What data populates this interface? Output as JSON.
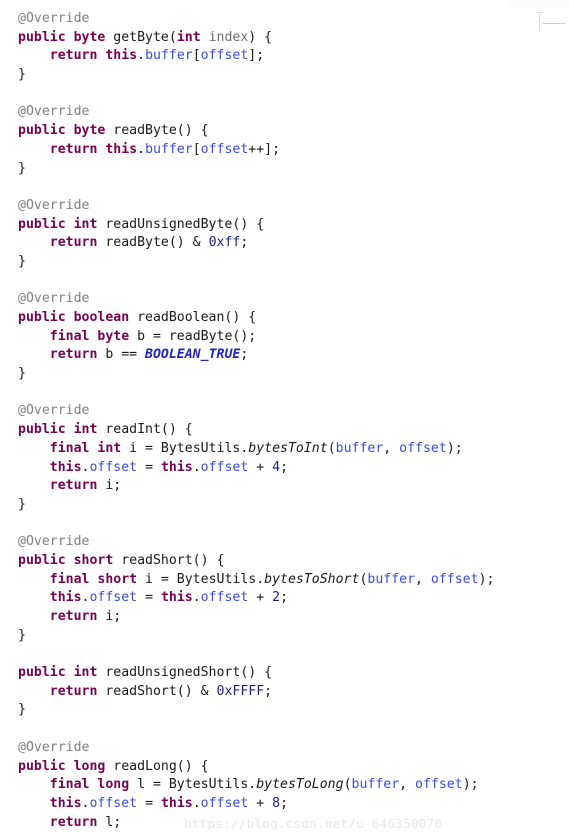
{
  "editor": {
    "language": "java",
    "background_color": "#ffffff",
    "theme_colors": {
      "annotation": "#808080",
      "keyword": "#7a0052",
      "plain": "#1a1a1a",
      "parameter": "#6e6e6e",
      "field": "#3a4be0",
      "constant": "#2323c8",
      "static_method": "#1a1a1a",
      "number": "#202080"
    }
  },
  "artifacts": {
    "bottom_watermark_text": "https://blog.csdn.net/u_646350070"
  },
  "code": {
    "lines": [
      [
        {
          "t": "@Override",
          "c": "ann"
        }
      ],
      [
        {
          "t": "public byte ",
          "c": "kw"
        },
        {
          "t": "getByte(",
          "c": "plain"
        },
        {
          "t": "int",
          "c": "kw"
        },
        {
          "t": " index",
          "c": "param"
        },
        {
          "t": ") {",
          "c": "plain"
        }
      ],
      [
        {
          "t": "    ",
          "c": "plain"
        },
        {
          "t": "return this",
          "c": "kw"
        },
        {
          "t": ".",
          "c": "plain"
        },
        {
          "t": "buffer",
          "c": "field"
        },
        {
          "t": "[",
          "c": "plain"
        },
        {
          "t": "offset",
          "c": "field"
        },
        {
          "t": "];",
          "c": "plain"
        }
      ],
      [
        {
          "t": "}",
          "c": "plain"
        }
      ],
      [
        {
          "t": "",
          "c": "plain"
        }
      ],
      [
        {
          "t": "@Override",
          "c": "ann"
        }
      ],
      [
        {
          "t": "public byte ",
          "c": "kw"
        },
        {
          "t": "readByte() {",
          "c": "plain"
        }
      ],
      [
        {
          "t": "    ",
          "c": "plain"
        },
        {
          "t": "return this",
          "c": "kw"
        },
        {
          "t": ".",
          "c": "plain"
        },
        {
          "t": "buffer",
          "c": "field"
        },
        {
          "t": "[",
          "c": "plain"
        },
        {
          "t": "offset",
          "c": "field"
        },
        {
          "t": "++];",
          "c": "plain"
        }
      ],
      [
        {
          "t": "}",
          "c": "plain"
        }
      ],
      [
        {
          "t": "",
          "c": "plain"
        }
      ],
      [
        {
          "t": "@Override",
          "c": "ann"
        }
      ],
      [
        {
          "t": "public int ",
          "c": "kw"
        },
        {
          "t": "readUnsignedByte() {",
          "c": "plain"
        }
      ],
      [
        {
          "t": "    ",
          "c": "plain"
        },
        {
          "t": "return",
          "c": "kw"
        },
        {
          "t": " readByte() & ",
          "c": "plain"
        },
        {
          "t": "0xff",
          "c": "num"
        },
        {
          "t": ";",
          "c": "plain"
        }
      ],
      [
        {
          "t": "}",
          "c": "plain"
        }
      ],
      [
        {
          "t": "",
          "c": "plain"
        }
      ],
      [
        {
          "t": "@Override",
          "c": "ann"
        }
      ],
      [
        {
          "t": "public boolean ",
          "c": "kw"
        },
        {
          "t": "readBoolean() {",
          "c": "plain"
        }
      ],
      [
        {
          "t": "    ",
          "c": "plain"
        },
        {
          "t": "final byte",
          "c": "kw"
        },
        {
          "t": " b = readByte();",
          "c": "plain"
        }
      ],
      [
        {
          "t": "    ",
          "c": "plain"
        },
        {
          "t": "return",
          "c": "kw"
        },
        {
          "t": " b == ",
          "c": "plain"
        },
        {
          "t": "BOOLEAN_TRUE",
          "c": "const"
        },
        {
          "t": ";",
          "c": "plain"
        }
      ],
      [
        {
          "t": "}",
          "c": "plain"
        }
      ],
      [
        {
          "t": "",
          "c": "plain"
        }
      ],
      [
        {
          "t": "@Override",
          "c": "ann"
        }
      ],
      [
        {
          "t": "public int ",
          "c": "kw"
        },
        {
          "t": "readInt() {",
          "c": "plain"
        }
      ],
      [
        {
          "t": "    ",
          "c": "plain"
        },
        {
          "t": "final int",
          "c": "kw"
        },
        {
          "t": " i = BytesUtils.",
          "c": "plain"
        },
        {
          "t": "bytesToInt",
          "c": "static"
        },
        {
          "t": "(",
          "c": "plain"
        },
        {
          "t": "buffer",
          "c": "field"
        },
        {
          "t": ", ",
          "c": "plain"
        },
        {
          "t": "offset",
          "c": "field"
        },
        {
          "t": ");",
          "c": "plain"
        }
      ],
      [
        {
          "t": "    ",
          "c": "plain"
        },
        {
          "t": "this",
          "c": "kw"
        },
        {
          "t": ".",
          "c": "plain"
        },
        {
          "t": "offset",
          "c": "field"
        },
        {
          "t": " = ",
          "c": "plain"
        },
        {
          "t": "this",
          "c": "kw"
        },
        {
          "t": ".",
          "c": "plain"
        },
        {
          "t": "offset",
          "c": "field"
        },
        {
          "t": " + ",
          "c": "plain"
        },
        {
          "t": "4",
          "c": "num"
        },
        {
          "t": ";",
          "c": "plain"
        }
      ],
      [
        {
          "t": "    ",
          "c": "plain"
        },
        {
          "t": "return",
          "c": "kw"
        },
        {
          "t": " i;",
          "c": "plain"
        }
      ],
      [
        {
          "t": "}",
          "c": "plain"
        }
      ],
      [
        {
          "t": "",
          "c": "plain"
        }
      ],
      [
        {
          "t": "@Override",
          "c": "ann"
        }
      ],
      [
        {
          "t": "public short ",
          "c": "kw"
        },
        {
          "t": "readShort() {",
          "c": "plain"
        }
      ],
      [
        {
          "t": "    ",
          "c": "plain"
        },
        {
          "t": "final short",
          "c": "kw"
        },
        {
          "t": " i = BytesUtils.",
          "c": "plain"
        },
        {
          "t": "bytesToShort",
          "c": "static"
        },
        {
          "t": "(",
          "c": "plain"
        },
        {
          "t": "buffer",
          "c": "field"
        },
        {
          "t": ", ",
          "c": "plain"
        },
        {
          "t": "offset",
          "c": "field"
        },
        {
          "t": ");",
          "c": "plain"
        }
      ],
      [
        {
          "t": "    ",
          "c": "plain"
        },
        {
          "t": "this",
          "c": "kw"
        },
        {
          "t": ".",
          "c": "plain"
        },
        {
          "t": "offset",
          "c": "field"
        },
        {
          "t": " = ",
          "c": "plain"
        },
        {
          "t": "this",
          "c": "kw"
        },
        {
          "t": ".",
          "c": "plain"
        },
        {
          "t": "offset",
          "c": "field"
        },
        {
          "t": " + ",
          "c": "plain"
        },
        {
          "t": "2",
          "c": "num"
        },
        {
          "t": ";",
          "c": "plain"
        }
      ],
      [
        {
          "t": "    ",
          "c": "plain"
        },
        {
          "t": "return",
          "c": "kw"
        },
        {
          "t": " i;",
          "c": "plain"
        }
      ],
      [
        {
          "t": "}",
          "c": "plain"
        }
      ],
      [
        {
          "t": "",
          "c": "plain"
        }
      ],
      [
        {
          "t": "public int ",
          "c": "kw"
        },
        {
          "t": "readUnsignedShort() {",
          "c": "plain"
        }
      ],
      [
        {
          "t": "    ",
          "c": "plain"
        },
        {
          "t": "return",
          "c": "kw"
        },
        {
          "t": " readShort() & ",
          "c": "plain"
        },
        {
          "t": "0xFFFF",
          "c": "num"
        },
        {
          "t": ";",
          "c": "plain"
        }
      ],
      [
        {
          "t": "}",
          "c": "plain"
        }
      ],
      [
        {
          "t": "",
          "c": "plain"
        }
      ],
      [
        {
          "t": "@Override",
          "c": "ann"
        }
      ],
      [
        {
          "t": "public long ",
          "c": "kw"
        },
        {
          "t": "readLong() {",
          "c": "plain"
        }
      ],
      [
        {
          "t": "    ",
          "c": "plain"
        },
        {
          "t": "final long",
          "c": "kw"
        },
        {
          "t": " l = BytesUtils.",
          "c": "plain"
        },
        {
          "t": "bytesToLong",
          "c": "static"
        },
        {
          "t": "(",
          "c": "plain"
        },
        {
          "t": "buffer",
          "c": "field"
        },
        {
          "t": ", ",
          "c": "plain"
        },
        {
          "t": "offset",
          "c": "field"
        },
        {
          "t": ");",
          "c": "plain"
        }
      ],
      [
        {
          "t": "    ",
          "c": "plain"
        },
        {
          "t": "this",
          "c": "kw"
        },
        {
          "t": ".",
          "c": "plain"
        },
        {
          "t": "offset",
          "c": "field"
        },
        {
          "t": " = ",
          "c": "plain"
        },
        {
          "t": "this",
          "c": "kw"
        },
        {
          "t": ".",
          "c": "plain"
        },
        {
          "t": "offset",
          "c": "field"
        },
        {
          "t": " + ",
          "c": "plain"
        },
        {
          "t": "8",
          "c": "num"
        },
        {
          "t": ";",
          "c": "plain"
        }
      ],
      [
        {
          "t": "    ",
          "c": "plain"
        },
        {
          "t": "return",
          "c": "kw"
        },
        {
          "t": " l;",
          "c": "plain"
        }
      ]
    ]
  }
}
